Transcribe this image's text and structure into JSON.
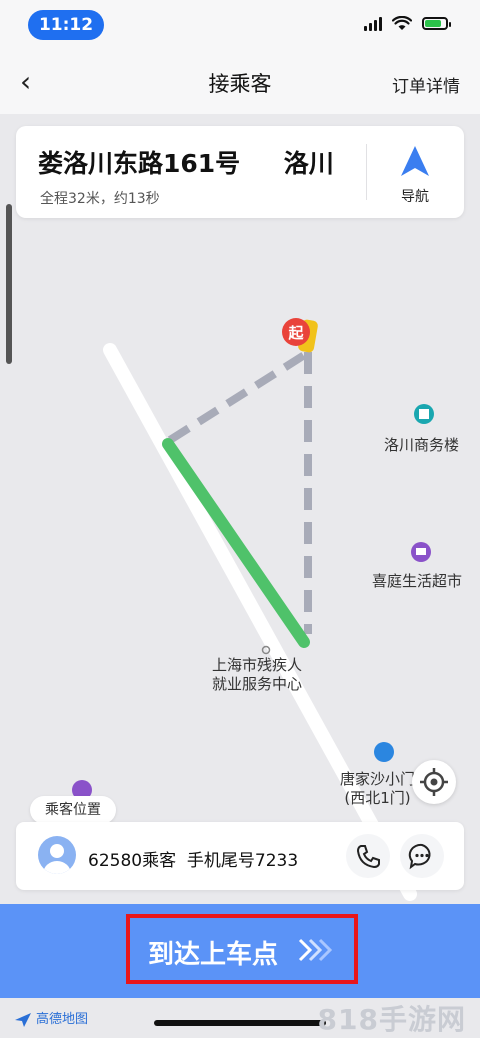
{
  "status_bar": {
    "time": "11:12"
  },
  "nav": {
    "title": "接乘客",
    "right_link": "订单详情"
  },
  "address_card": {
    "address": "娄洛川东路161号     洛川",
    "summary": "全程32米，约13秒",
    "navigate_label": "导航"
  },
  "map": {
    "start_marker": "起",
    "pois": [
      {
        "label": "洛川商务楼"
      },
      {
        "label": "喜庭生活超市"
      },
      {
        "label": "上海市残疾人\n就业服务中心"
      },
      {
        "label": "唐家沙小门\n(西北1门)"
      }
    ],
    "colors": {
      "route": "#4fc26a",
      "dashed": "#a8abb8",
      "poi_teal": "#1aa7b0",
      "poi_purple": "#8a52c9"
    }
  },
  "passenger": {
    "tag": "乘客位置",
    "info": "62580乘客  手机尾号7233"
  },
  "action": {
    "label": "到达上车点",
    "color": "#5b93f7",
    "highlight": "#e8161c"
  },
  "footer": {
    "map_brand": "高德地图",
    "watermark": "818手游网"
  }
}
